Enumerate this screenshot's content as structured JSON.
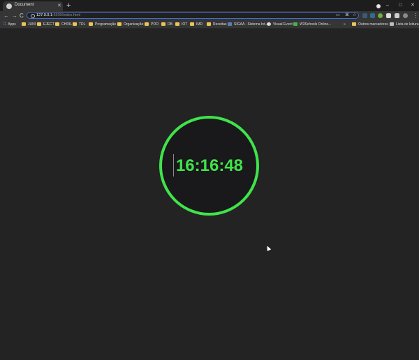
{
  "browser": {
    "tab": {
      "title": "Document"
    },
    "new_tab_label": "+",
    "window_controls": {
      "minimize": "–",
      "maximize": "□",
      "close": "✕"
    },
    "nav": {
      "back": "←",
      "forward": "→",
      "reload": "C"
    },
    "address": {
      "host": "127.0.0.1",
      "rest": ":5500/index.html"
    },
    "bookmarks": [
      {
        "label": "Apps",
        "icon": "apps-grid-icon"
      },
      {
        "label": "JUNI",
        "icon": "folder-icon"
      },
      {
        "label": "EJECT",
        "icon": "folder-icon"
      },
      {
        "label": "CHRIL",
        "icon": "folder-icon"
      },
      {
        "label": "TDL",
        "icon": "folder-icon"
      },
      {
        "label": "Programação",
        "icon": "folder-icon"
      },
      {
        "label": "Organização",
        "icon": "folder-icon"
      },
      {
        "label": "POO",
        "icon": "folder-icon"
      },
      {
        "label": "DB",
        "icon": "folder-icon"
      },
      {
        "label": "IOT",
        "icon": "folder-icon"
      },
      {
        "label": "IMD",
        "icon": "folder-icon"
      },
      {
        "label": "Receitas",
        "icon": "folder-icon"
      },
      {
        "label": "SIGAA - Sistema Int...",
        "icon": "sigaa-icon"
      },
      {
        "label": "Visual Event",
        "icon": "globe-icon"
      },
      {
        "label": "W3Schools Online...",
        "icon": "w3schools-icon"
      },
      {
        "label": "Outros marcadores",
        "icon": "folder-icon"
      },
      {
        "label": "Lista de leitura",
        "icon": "reading-list-icon"
      }
    ],
    "overflow_label": "»"
  },
  "clock": {
    "time": "16:16:48",
    "accent_color": "#3fe44a",
    "face_color": "#19181a"
  },
  "colors": {
    "page_bg": "#232323",
    "toolbar_bg": "#353535",
    "tabstrip_bg": "#1d1d1d"
  }
}
